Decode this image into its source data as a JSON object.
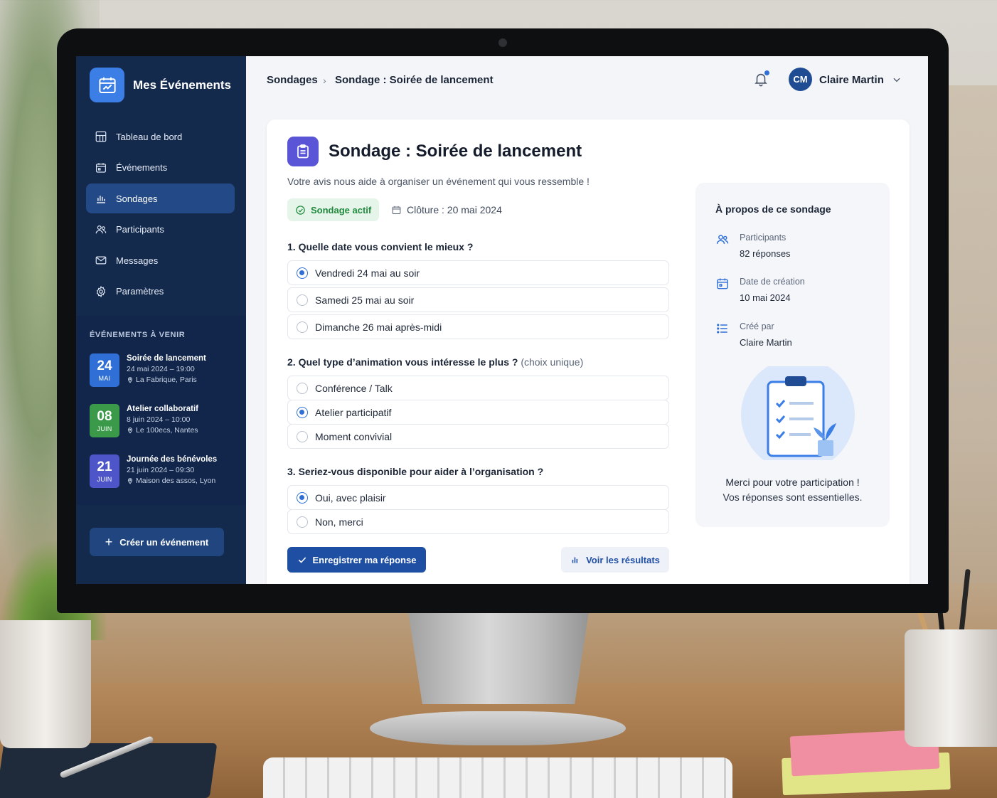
{
  "sidebar": {
    "brand": "Mes Événements",
    "nav": [
      {
        "label": "Tableau de bord",
        "icon": "dashboard-icon"
      },
      {
        "label": "Événements",
        "icon": "calendar-icon"
      },
      {
        "label": "Sondages",
        "icon": "bar-chart-icon",
        "active": true
      },
      {
        "label": "Participants",
        "icon": "users-icon"
      },
      {
        "label": "Messages",
        "icon": "mail-icon"
      },
      {
        "label": "Paramètres",
        "icon": "gear-icon"
      }
    ],
    "upcoming_title": "ÉVÉNEMENTS À VENIR",
    "events": [
      {
        "day": "24",
        "month": "MAI",
        "name": "Soirée de lancement",
        "when": "24 mai 2024 – 19:00",
        "where": "La Fabrique, Paris",
        "color": "#2f6fd6"
      },
      {
        "day": "08",
        "month": "JUIN",
        "name": "Atelier collaboratif",
        "when": "8 juin 2024 – 10:00",
        "where": "Le 100ecs, Nantes",
        "color": "#3a9a4a"
      },
      {
        "day": "21",
        "month": "JUIN",
        "name": "Journée des bénévoles",
        "when": "21 juin 2024 – 09:30",
        "where": "Maison des assos, Lyon",
        "color": "#4d55c8"
      }
    ],
    "create_label": "Créer un événement"
  },
  "topbar": {
    "crumb_root": "Sondages",
    "crumb_sep": "›",
    "crumb_current": "Sondage : Soirée de lancement",
    "avatar_initials": "CM",
    "user_name": "Claire Martin"
  },
  "survey": {
    "title": "Sondage : Soirée de lancement",
    "subtitle": "Votre avis nous aide à organiser un événement qui vous ressemble !",
    "status": "Sondage actif",
    "deadline": "Clôture : 20 mai 2024",
    "questions": [
      {
        "label": "1. Quelle date vous convient le mieux ?",
        "hint": "",
        "options": [
          {
            "label": "Vendredi 24 mai au soir",
            "selected": true
          },
          {
            "label": "Samedi 25 mai au soir",
            "selected": false
          },
          {
            "label": "Dimanche 26 mai après-midi",
            "selected": false
          }
        ]
      },
      {
        "label": "2. Quel type d’animation vous intéresse le plus ?",
        "hint": "(choix unique)",
        "options": [
          {
            "label": "Conférence / Talk",
            "selected": false
          },
          {
            "label": "Atelier participatif",
            "selected": true
          },
          {
            "label": "Moment convivial",
            "selected": false
          }
        ]
      },
      {
        "label": "3. Seriez-vous disponible pour aider à l’organisation ?",
        "hint": "",
        "options": [
          {
            "label": "Oui, avec plaisir",
            "selected": true
          },
          {
            "label": "Non, merci",
            "selected": false
          }
        ]
      }
    ],
    "save_label": "Enregistrer ma réponse",
    "results_label": "Voir les résultats"
  },
  "about": {
    "title": "À propos de ce sondage",
    "rows": [
      {
        "key": "Participants",
        "value": "82 réponses",
        "icon": "users-icon"
      },
      {
        "key": "Date de création",
        "value": "10 mai 2024",
        "icon": "calendar-icon"
      },
      {
        "key": "Créé par",
        "value": "Claire Martin",
        "icon": "list-icon"
      }
    ],
    "thanks": "Merci pour votre participation !",
    "thanks2": "Vos réponses sont essentielles."
  },
  "colors": {
    "sidebar": "#142a4d",
    "accent": "#2f6fd6",
    "primary_button": "#1f4fa3",
    "active_badge": "#1f8a3d"
  }
}
